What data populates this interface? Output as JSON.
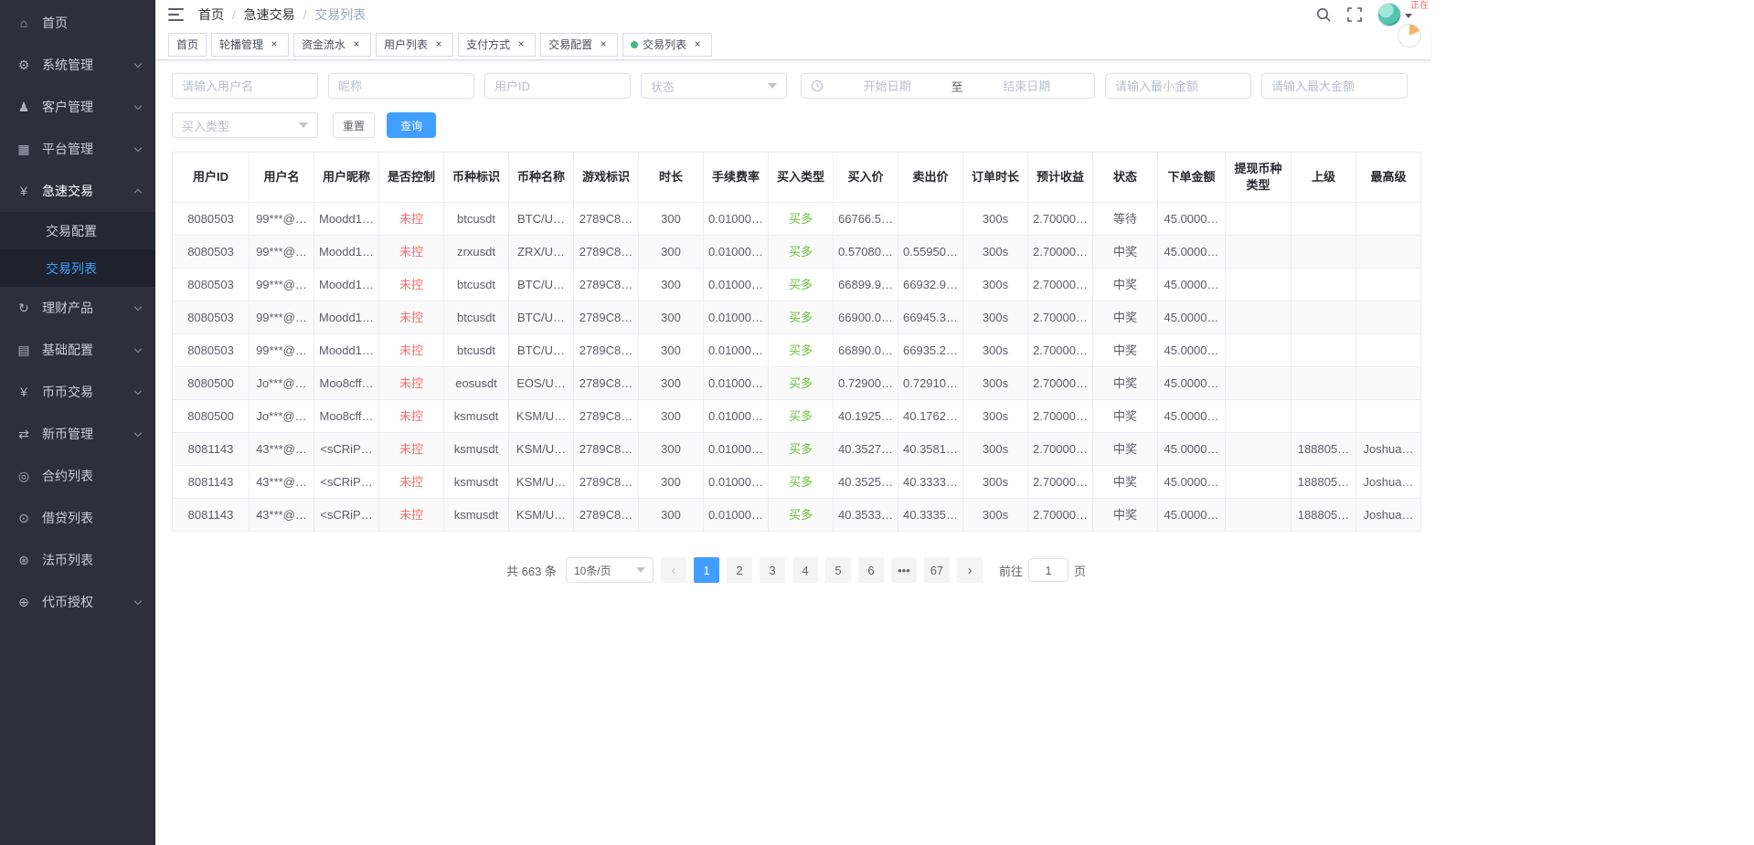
{
  "header": {
    "breadcrumb": [
      "首页",
      "急速交易",
      "交易列表"
    ],
    "corner_note": "正在"
  },
  "tabs": [
    {
      "label": "首页",
      "closable": false,
      "active": false
    },
    {
      "label": "轮播管理",
      "closable": true,
      "active": false
    },
    {
      "label": "资金流水",
      "closable": true,
      "active": false
    },
    {
      "label": "用户列表",
      "closable": true,
      "active": false
    },
    {
      "label": "支付方式",
      "closable": true,
      "active": false
    },
    {
      "label": "交易配置",
      "closable": true,
      "active": false
    },
    {
      "label": "交易列表",
      "closable": true,
      "active": true
    }
  ],
  "sidebar": {
    "items": [
      {
        "label": "首页",
        "icon": "home",
        "has_children": false
      },
      {
        "label": "系统管理",
        "icon": "settings",
        "has_children": true
      },
      {
        "label": "客户管理",
        "icon": "customers",
        "has_children": true
      },
      {
        "label": "平台管理",
        "icon": "platform",
        "has_children": true
      },
      {
        "label": "急速交易",
        "icon": "yen",
        "has_children": true,
        "expanded": true,
        "children": [
          {
            "label": "交易配置",
            "active": false
          },
          {
            "label": "交易列表",
            "active": true
          }
        ]
      },
      {
        "label": "理财产品",
        "icon": "finance",
        "has_children": true
      },
      {
        "label": "基础配置",
        "icon": "config",
        "has_children": true
      },
      {
        "label": "币币交易",
        "icon": "yen",
        "has_children": true
      },
      {
        "label": "新币管理",
        "icon": "swap",
        "has_children": true
      },
      {
        "label": "合约列表",
        "icon": "ring",
        "has_children": false
      },
      {
        "label": "借贷列表",
        "icon": "dotring",
        "has_children": false
      },
      {
        "label": "法币列表",
        "icon": "disc",
        "has_children": false
      },
      {
        "label": "代币授权",
        "icon": "globe",
        "has_children": true
      }
    ]
  },
  "filters": {
    "username_placeholder": "请输入用户名",
    "nickname_placeholder": "昵称",
    "userid_placeholder": "用户ID",
    "status_placeholder": "状态",
    "date_start_placeholder": "开始日期",
    "date_separator": "至",
    "date_end_placeholder": "结束日期",
    "min_amount_placeholder": "请输入最小金额",
    "max_amount_placeholder": "请输入最大金额",
    "buy_type_placeholder": "买入类型",
    "reset_label": "重置",
    "query_label": "查询"
  },
  "table": {
    "columns": [
      "用户ID",
      "用户名",
      "用户昵称",
      "是否控制",
      "币种标识",
      "币种名称",
      "游戏标识",
      "时长",
      "手续费率",
      "买入类型",
      "买入价",
      "卖出价",
      "订单时长",
      "预计收益",
      "状态",
      "下单金额",
      "提现币种类型",
      "上级",
      "最高级"
    ],
    "rows": [
      [
        "8080503",
        "99***@…",
        "Moodd1…",
        "未控",
        "btcusdt",
        "BTC/U…",
        "2789C8…",
        "300",
        "0.01000…",
        "买多",
        "66766.5…",
        "",
        "300s",
        "2.70000…",
        "等待",
        "45.0000…",
        "",
        "",
        ""
      ],
      [
        "8080503",
        "99***@…",
        "Moodd1…",
        "未控",
        "zrxusdt",
        "ZRX/U…",
        "2789C8…",
        "300",
        "0.01000…",
        "买多",
        "0.57080…",
        "0.55950…",
        "300s",
        "2.70000…",
        "中奖",
        "45.0000…",
        "",
        "",
        ""
      ],
      [
        "8080503",
        "99***@…",
        "Moodd1…",
        "未控",
        "btcusdt",
        "BTC/U…",
        "2789C8…",
        "300",
        "0.01000…",
        "买多",
        "66899.9…",
        "66932.9…",
        "300s",
        "2.70000…",
        "中奖",
        "45.0000…",
        "",
        "",
        ""
      ],
      [
        "8080503",
        "99***@…",
        "Moodd1…",
        "未控",
        "btcusdt",
        "BTC/U…",
        "2789C8…",
        "300",
        "0.01000…",
        "买多",
        "66900.0…",
        "66945.3…",
        "300s",
        "2.70000…",
        "中奖",
        "45.0000…",
        "",
        "",
        ""
      ],
      [
        "8080503",
        "99***@…",
        "Moodd1…",
        "未控",
        "btcusdt",
        "BTC/U…",
        "2789C8…",
        "300",
        "0.01000…",
        "买多",
        "66890.0…",
        "66935.2…",
        "300s",
        "2.70000…",
        "中奖",
        "45.0000…",
        "",
        "",
        ""
      ],
      [
        "8080500",
        "Jo***@…",
        "Moo8cff…",
        "未控",
        "eosusdt",
        "EOS/U…",
        "2789C8…",
        "300",
        "0.01000…",
        "买多",
        "0.72900…",
        "0.72910…",
        "300s",
        "2.70000…",
        "中奖",
        "45.0000…",
        "",
        "",
        ""
      ],
      [
        "8080500",
        "Jo***@…",
        "Moo8cff…",
        "未控",
        "ksmusdt",
        "KSM/U…",
        "2789C8…",
        "300",
        "0.01000…",
        "买多",
        "40.1925…",
        "40.1762…",
        "300s",
        "2.70000…",
        "中奖",
        "45.0000…",
        "",
        "",
        ""
      ],
      [
        "8081143",
        "43***@…",
        "<sCRiP…",
        "未控",
        "ksmusdt",
        "KSM/U…",
        "2789C8…",
        "300",
        "0.01000…",
        "买多",
        "40.3527…",
        "40.3581…",
        "300s",
        "2.70000…",
        "中奖",
        "45.0000…",
        "",
        "188805…",
        "Joshua…"
      ],
      [
        "8081143",
        "43***@…",
        "<sCRiP…",
        "未控",
        "ksmusdt",
        "KSM/U…",
        "2789C8…",
        "300",
        "0.01000…",
        "买多",
        "40.3525…",
        "40.3333…",
        "300s",
        "2.70000…",
        "中奖",
        "45.0000…",
        "",
        "188805…",
        "Joshua…"
      ],
      [
        "8081143",
        "43***@…",
        "<sCRiP…",
        "未控",
        "ksmusdt",
        "KSM/U…",
        "2789C8…",
        "300",
        "0.01000…",
        "买多",
        "40.3533…",
        "40.3335…",
        "300s",
        "2.70000…",
        "中奖",
        "45.0000…",
        "",
        "188805…",
        "Joshua…"
      ]
    ]
  },
  "pagination": {
    "total_label": "共 663 条",
    "page_size_label": "10条/页",
    "pages": [
      "1",
      "2",
      "3",
      "4",
      "5",
      "6",
      "...",
      "67"
    ],
    "active_page": "1",
    "prev_label": "‹",
    "next_label": "›",
    "jump_prefix": "前往",
    "jump_value": "1",
    "jump_suffix": "页"
  },
  "colors": {
    "accent": "#409EFF",
    "danger": "#F56C6C",
    "success": "#67C23A",
    "tab_dot": "#42B983",
    "sidebar_bg": "#2B303B"
  }
}
